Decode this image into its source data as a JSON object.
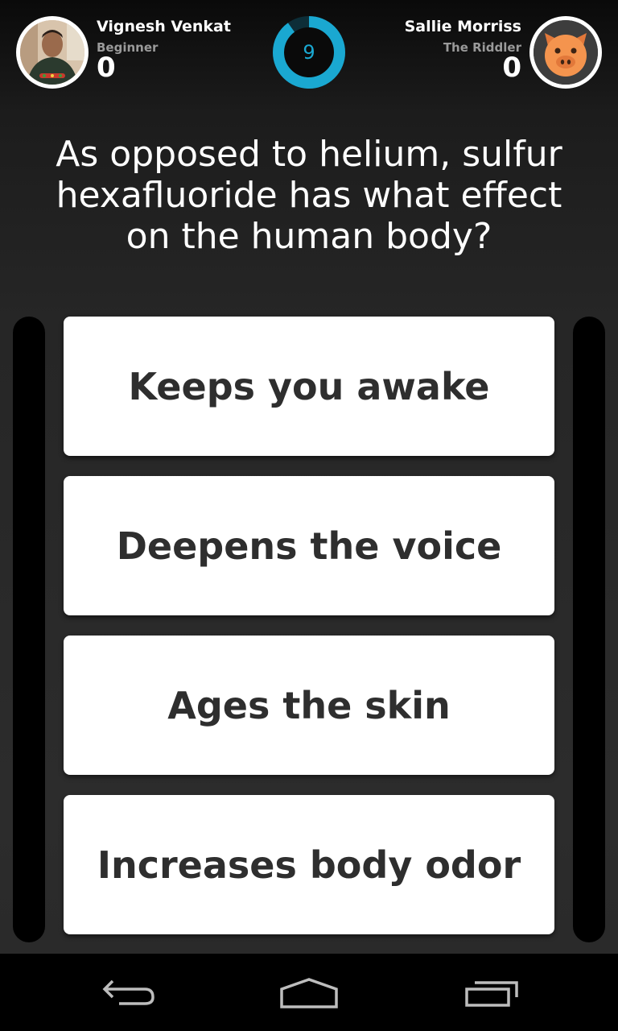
{
  "player1": {
    "name": "Vignesh Venkat",
    "rank": "Beginner",
    "score": "0"
  },
  "player2": {
    "name": "Sallie Morriss",
    "rank": "The Riddler",
    "score": "0"
  },
  "timer": {
    "seconds": "9",
    "remaining_fraction": 0.9,
    "accent_color": "#1aa8d1"
  },
  "question": "As opposed to helium, sulfur hexafluoride has what effect on the human body?",
  "answers": [
    {
      "label": "Keeps you awake"
    },
    {
      "label": "Deepens the voice"
    },
    {
      "label": "Ages the skin"
    },
    {
      "label": "Increases body odor"
    }
  ],
  "nav": {
    "back": "back-icon",
    "home": "home-icon",
    "recents": "recent-apps-icon"
  }
}
